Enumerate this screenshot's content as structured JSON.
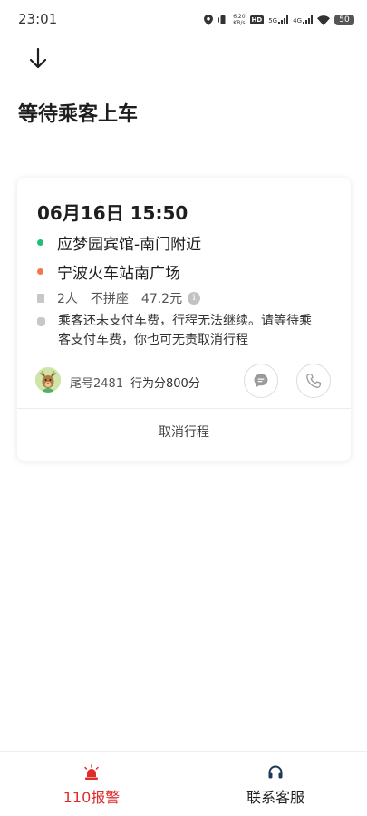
{
  "status_bar": {
    "time": "23:01",
    "net_speed_value": "6.20",
    "net_speed_unit": "KB/s",
    "hd_badge": "HD",
    "network_1": "5G",
    "network_2": "4G",
    "battery": "50"
  },
  "header": {
    "back_icon": "arrow-down-icon",
    "title": "等待乘客上车"
  },
  "order_card": {
    "ride_time": "06月16日 15:50",
    "start_location": "应梦园宾馆-南门附近",
    "end_location": "宁波火车站南广场",
    "passengers": "2人",
    "carpool": "不拼座",
    "fare": "47.2元",
    "notice": "乘客还未支付车费，行程无法继续。请等待乘客支付车费，你也可无责取消行程",
    "passenger_tail_no": "尾号2481",
    "behavior_score": "行为分800分",
    "cancel_label": "取消行程",
    "start_dot_color": "#1fbf7a",
    "end_dot_color": "#f2784b"
  },
  "bottom_bar": {
    "police_label": "110报警",
    "service_label": "联系客服",
    "police_color": "#e02b2b"
  }
}
